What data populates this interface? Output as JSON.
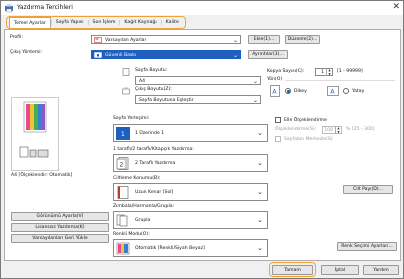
{
  "window": {
    "title": "Yazdırma Tercihleri"
  },
  "tabs": [
    "Temel Ayarlar",
    "Sayfa Yapısı",
    "Son İşlem",
    "Kağıt Kaynağı",
    "Kalite"
  ],
  "profile": {
    "label": "Profil:",
    "value": "Varsayılan Ayarlar",
    "add": "Ekle(1)...",
    "edit": "Düzenle(2)..."
  },
  "output": {
    "label": "Çıkış Yöntemi:",
    "value": "Güvenli Baskı",
    "details": "Ayrıntılar(3)..."
  },
  "page_size": {
    "label": "Sayfa Boyutu:",
    "value": "A4"
  },
  "output_size": {
    "label": "Çıkış Boyutu(Z):",
    "value": "Sayfa Boyutuna Eşleştir"
  },
  "copies": {
    "label": "Kopya Sayısı(C):",
    "value": "1",
    "range": "[1 - 99999]"
  },
  "orientation": {
    "label": "Yön(O)",
    "portrait": "Dikey",
    "landscape": "Yatay",
    "selected": "Dikey"
  },
  "preview_caption": "A4 [Ölçeklendir: Otomatik]",
  "page_layout": {
    "label": "Sayfa Yerleşimi:",
    "value": "1 Üzerinde 1"
  },
  "duplex": {
    "label": "1 taraflı/2 taraflı/Kitapçık Yazdırma:",
    "value": "2 Taraflı Yazdırma"
  },
  "binding": {
    "label": "Ciltleme Konumu(B):",
    "value": "Uzun Kenar [Sol]",
    "button": "Cilt Payı(D)..."
  },
  "collate": {
    "label": "Zımbala/Harmanla/Grupla:",
    "value": "Grupla"
  },
  "color_mode": {
    "label": "Renkli Modu(O):",
    "value": "Otomatik [Renkli/Siyah Beyaz]",
    "button": "Renk Seçimi Ayarları..."
  },
  "manual_scaling": {
    "label": "Elle Ölçeklendirme",
    "scale_label": "Ölçeklendirme(S):",
    "scale_value": "100",
    "scale_range": "% [25 - 300]"
  },
  "booklet": {
    "label": "Sayfaları Merkezle(S)"
  },
  "left_buttons": [
    "Görünümü Ayarla(V)",
    "Lisanssız Yazdırma(K)",
    "Varsayılanları Geri Yükle"
  ],
  "footer": {
    "ok": "Tamam",
    "cancel": "İptal",
    "help": "Yardım"
  },
  "colors": {
    "accent": "#f0a23a",
    "selection": "#1f5fbf"
  }
}
